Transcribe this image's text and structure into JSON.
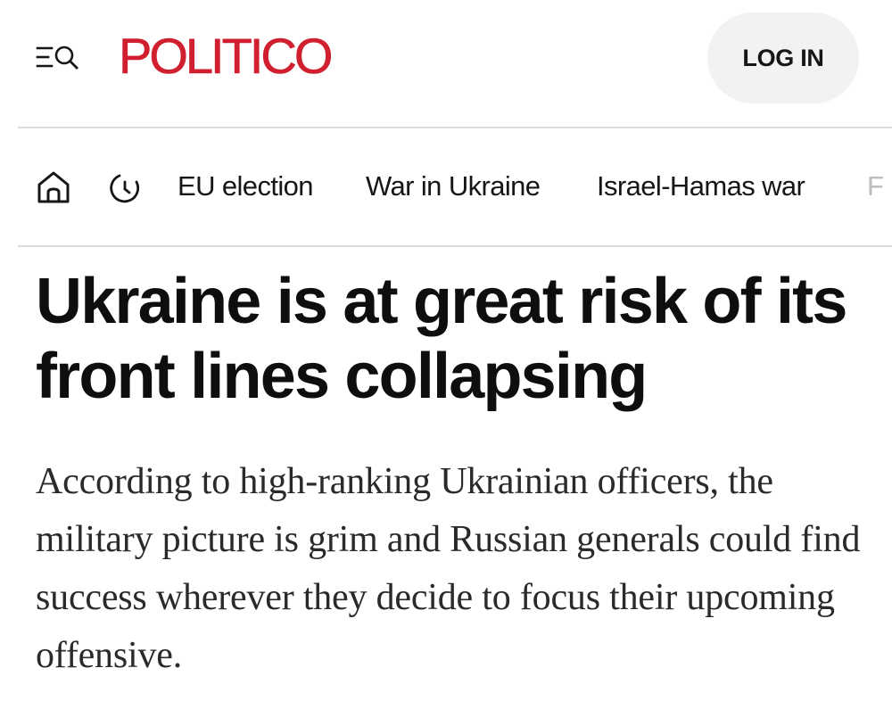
{
  "header": {
    "menu_search_icon": "menu-search-icon",
    "logo_text": "POLITICO",
    "logo_color": "#d01f2e",
    "login_label": "LOG IN"
  },
  "nav": {
    "home_icon": "home-icon",
    "latest_icon": "clock-icon",
    "links": [
      {
        "label": "EU election"
      },
      {
        "label": "War in Ukraine"
      },
      {
        "label": "Israel-Hamas war"
      },
      {
        "label": "F"
      }
    ]
  },
  "article": {
    "headline": "Ukraine is at great risk of its front lines collapsing",
    "dek": "According to high-ranking Ukrainian officers, the military picture is grim and Russian generals could find success wherever they decide to focus their upcoming offensive."
  }
}
